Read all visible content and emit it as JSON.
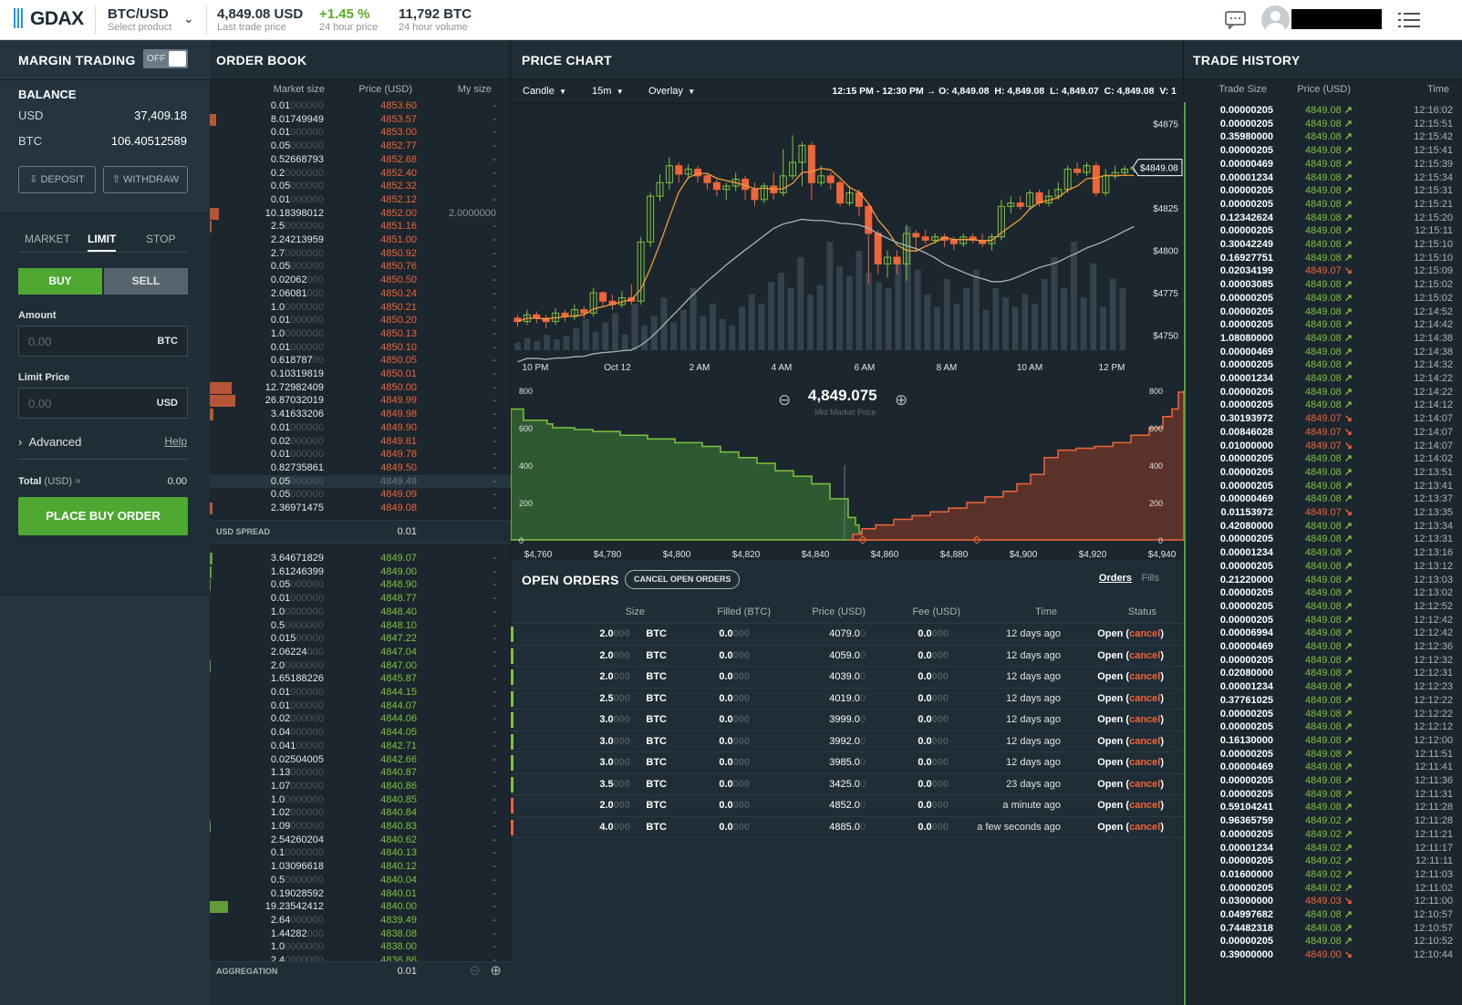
{
  "header": {
    "logo": "GDAX",
    "product": "BTC/USD",
    "product_sub": "Select product",
    "last_price": "4,849.08 USD",
    "last_price_sub": "Last trade price",
    "change": "+1.45 %",
    "change_sub": "24 hour price",
    "volume": "11,792 BTC",
    "volume_sub": "24 hour volume"
  },
  "left": {
    "margin_title": "MARGIN TRADING",
    "toggle": "OFF",
    "balance_title": "BALANCE",
    "usd_label": "USD",
    "usd_value": "37,409.18",
    "btc_label": "BTC",
    "btc_value": "106.40512589",
    "deposit": "DEPOSIT",
    "withdraw": "WITHDRAW",
    "tabs": [
      "MARKET",
      "LIMIT",
      "STOP"
    ],
    "buy": "BUY",
    "sell": "SELL",
    "amount_label": "Amount",
    "amount_placeholder": "0.00",
    "amount_unit": "BTC",
    "limit_label": "Limit Price",
    "limit_placeholder": "0.00",
    "limit_unit": "USD",
    "advanced": "Advanced",
    "help": "Help",
    "total_label": "Total",
    "total_unit": "(USD) ≈",
    "total_value": "0.00",
    "place": "PLACE BUY ORDER"
  },
  "orderbook": {
    "title": "ORDER BOOK",
    "col_size": "Market size",
    "col_price": "Price (USD)",
    "col_my": "My size",
    "spread_label": "USD SPREAD",
    "spread_value": "0.01",
    "aggregation_label": "AGGREGATION",
    "aggregation_value": "0.01",
    "asks": [
      [
        "0.01",
        "000000",
        "4853.",
        "60",
        "-"
      ],
      [
        "8.01749949",
        "",
        "4853.",
        "57",
        "-"
      ],
      [
        "0.01",
        "000000",
        "4853.",
        "00",
        "-"
      ],
      [
        "0.05",
        "000000",
        "4852.",
        "77",
        "-"
      ],
      [
        "0.52668793",
        "",
        "4852.",
        "68",
        "-"
      ],
      [
        "0.2",
        "0000000",
        "4852.",
        "40",
        "-"
      ],
      [
        "0.05",
        "000000",
        "4852.",
        "32",
        "-"
      ],
      [
        "0.01",
        "000000",
        "4852.",
        "12",
        "-"
      ],
      [
        "10.18398012",
        "",
        "4852.",
        "00",
        "2.0000000"
      ],
      [
        "2.5",
        "0000000",
        "4851.",
        "16",
        "-"
      ],
      [
        "2.24213959",
        "",
        "4851.",
        "00",
        "-"
      ],
      [
        "2.7",
        "0000000",
        "4850.",
        "92",
        "-"
      ],
      [
        "0.05",
        "000000",
        "4850.",
        "76",
        "-"
      ],
      [
        "0.02062",
        "000",
        "4850.",
        "50",
        "-"
      ],
      [
        "2.06081",
        "000",
        "4850.",
        "24",
        "-"
      ],
      [
        "1.0",
        "0000000",
        "4850.",
        "21",
        "-"
      ],
      [
        "0.01",
        "000000",
        "4850.",
        "20",
        "-"
      ],
      [
        "1.0",
        "0000000",
        "4850.",
        "13",
        "-"
      ],
      [
        "0.01",
        "000000",
        "4850.",
        "10",
        "-"
      ],
      [
        "0.618787",
        "00",
        "4850.",
        "05",
        "-"
      ],
      [
        "0.10319819",
        "",
        "4850.",
        "01",
        "-"
      ],
      [
        "12.72982409",
        "",
        "4850.",
        "00",
        "-"
      ],
      [
        "26.87032019",
        "",
        "4849.",
        "99",
        "-"
      ],
      [
        "3.41633206",
        "",
        "4849.",
        "98",
        "-"
      ],
      [
        "0.01",
        "000000",
        "4849.",
        "90",
        "-"
      ],
      [
        "0.02",
        "000000",
        "4849.",
        "81",
        "-"
      ],
      [
        "0.01",
        "000000",
        "4849.",
        "78",
        "-"
      ],
      [
        "0.82735861",
        "",
        "4849.",
        "50",
        "-"
      ],
      [
        "0.05",
        "000000",
        "4849.",
        "49",
        "-"
      ],
      [
        "0.05",
        "000000",
        "4849.",
        "09",
        "-"
      ],
      [
        "2.36971475",
        "",
        "4849.",
        "08",
        "-"
      ]
    ],
    "bids": [
      [
        "3.64671829",
        "",
        "4849.",
        "07",
        "-"
      ],
      [
        "1.61246399",
        "",
        "4849.",
        "00",
        "-"
      ],
      [
        "0.05",
        "000000",
        "4848.",
        "90",
        "-"
      ],
      [
        "0.01",
        "000000",
        "4848.",
        "77",
        "-"
      ],
      [
        "1.0",
        "0000000",
        "4848.",
        "40",
        "-"
      ],
      [
        "0.5",
        "0000000",
        "4848.",
        "10",
        "-"
      ],
      [
        "0.015",
        "00000",
        "4847.",
        "22",
        "-"
      ],
      [
        "2.06224",
        "000",
        "4847.",
        "04",
        "-"
      ],
      [
        "2.0",
        "0000000",
        "4847.",
        "00",
        "-"
      ],
      [
        "1.65188226",
        "",
        "4845.",
        "87",
        "-"
      ],
      [
        "0.01",
        "000000",
        "4844.",
        "15",
        "-"
      ],
      [
        "0.01",
        "000000",
        "4844.",
        "07",
        "-"
      ],
      [
        "0.02",
        "000000",
        "4844.",
        "06",
        "-"
      ],
      [
        "0.04",
        "000000",
        "4844.",
        "05",
        "-"
      ],
      [
        "0.041",
        "00000",
        "4842.",
        "71",
        "-"
      ],
      [
        "0.02504005",
        "",
        "4842.",
        "66",
        "-"
      ],
      [
        "1.13",
        "000000",
        "4840.",
        "87",
        "-"
      ],
      [
        "1.07",
        "000000",
        "4840.",
        "86",
        "-"
      ],
      [
        "1.0",
        "0000000",
        "4840.",
        "85",
        "-"
      ],
      [
        "1.02",
        "000000",
        "4840.",
        "84",
        "-"
      ],
      [
        "1.09",
        "000000",
        "4840.",
        "83",
        "-"
      ],
      [
        "2.54260204",
        "",
        "4840.",
        "62",
        "-"
      ],
      [
        "0.1",
        "0000000",
        "4840.",
        "13",
        "-"
      ],
      [
        "1.03096618",
        "",
        "4840.",
        "12",
        "-"
      ],
      [
        "0.5",
        "0000000",
        "4840.",
        "04",
        "-"
      ],
      [
        "0.19028592",
        "",
        "4840.",
        "01",
        "-"
      ],
      [
        "19.23542412",
        "",
        "4840.",
        "00",
        "-"
      ],
      [
        "2.64",
        "000000",
        "4839.",
        "49",
        "-"
      ],
      [
        "1.44282",
        "000",
        "4838.",
        "08",
        "-"
      ],
      [
        "1.0",
        "0000000",
        "4838.",
        "00",
        "-"
      ],
      [
        "2.4",
        "0000000",
        "4836.",
        "86",
        "-"
      ]
    ]
  },
  "chart": {
    "title": "PRICE CHART",
    "candle": "Candle",
    "interval": "15m",
    "overlay": "Overlay",
    "ohlc": "12:15 PM - 12:30 PM → O: 4,849.08  H: 4,849.08  L: 4,849.07  C: 4,849.08  V: 1",
    "y_labels": [
      "$4875",
      "$4825",
      "$4800",
      "$4775",
      "$4750"
    ],
    "price_tag": "$4849.08",
    "x_labels": [
      "10 PM",
      "Oct 12",
      "2 AM",
      "4 AM",
      "6 AM",
      "8 AM",
      "10 AM",
      "12 PM"
    ],
    "mid_price": "4,849.075",
    "mid_label": "Mid Market Price",
    "depth_y": [
      "800",
      "600",
      "400",
      "200",
      "0"
    ],
    "depth_x": [
      "$4,760",
      "$4,780",
      "$4,800",
      "$4,820",
      "$4,840",
      "$4,860",
      "$4,880",
      "$4,900",
      "$4,920",
      "$4,940"
    ]
  },
  "orders": {
    "title": "OPEN ORDERS",
    "cancel_all": "CANCEL OPEN ORDERS",
    "tab_orders": "Orders",
    "tab_fills": "Fills",
    "cols": [
      "Size",
      "Filled (BTC)",
      "Price (USD)",
      "Fee (USD)",
      "Time",
      "Status"
    ],
    "rows": [
      [
        "2.0",
        "BTC",
        "0.0",
        "4079.0",
        "0.0",
        "12 days ago",
        "buy"
      ],
      [
        "2.0",
        "BTC",
        "0.0",
        "4059.0",
        "0.0",
        "12 days ago",
        "buy"
      ],
      [
        "2.0",
        "BTC",
        "0.0",
        "4039.0",
        "0.0",
        "12 days ago",
        "buy"
      ],
      [
        "2.5",
        "BTC",
        "0.0",
        "4019.0",
        "0.0",
        "12 days ago",
        "buy"
      ],
      [
        "3.0",
        "BTC",
        "0.0",
        "3999.0",
        "0.0",
        "12 days ago",
        "buy"
      ],
      [
        "3.0",
        "BTC",
        "0.0",
        "3992.0",
        "0.0",
        "12 days ago",
        "buy"
      ],
      [
        "3.0",
        "BTC",
        "0.0",
        "3985.0",
        "0.0",
        "12 days ago",
        "buy"
      ],
      [
        "3.5",
        "BTC",
        "0.0",
        "3425.0",
        "0.0",
        "23 days ago",
        "buy"
      ],
      [
        "2.0",
        "BTC",
        "0.0",
        "4852.0",
        "0.0",
        "a minute ago",
        "sell"
      ],
      [
        "4.0",
        "BTC",
        "0.0",
        "4885.0",
        "0.0",
        "a few seconds ago",
        "sell"
      ]
    ],
    "open": "Open",
    "cancel": "cancel"
  },
  "trades": {
    "title": "TRADE HISTORY",
    "col_size": "Trade Size",
    "col_price": "Price (USD)",
    "col_time": "Time",
    "rows": [
      [
        "0.00000205",
        "4849.08",
        "up",
        "12:16:02"
      ],
      [
        "0.00000205",
        "4849.08",
        "up",
        "12:15:51"
      ],
      [
        "0.35980000",
        "4849.08",
        "up",
        "12:15:42"
      ],
      [
        "0.00000205",
        "4849.08",
        "up",
        "12:15:41"
      ],
      [
        "0.00000469",
        "4849.08",
        "up",
        "12:15:39"
      ],
      [
        "0.00001234",
        "4849.08",
        "up",
        "12:15:34"
      ],
      [
        "0.00000205",
        "4849.08",
        "up",
        "12:15:31"
      ],
      [
        "0.00000205",
        "4849.08",
        "up",
        "12:15:21"
      ],
      [
        "0.12342624",
        "4849.08",
        "up",
        "12:15:20"
      ],
      [
        "0.00000205",
        "4849.08",
        "up",
        "12:15:11"
      ],
      [
        "0.30042249",
        "4849.08",
        "up",
        "12:15:10"
      ],
      [
        "0.16927751",
        "4849.08",
        "up",
        "12:15:10"
      ],
      [
        "0.02034199",
        "4849.07",
        "down",
        "12:15:09"
      ],
      [
        "0.00003085",
        "4849.08",
        "up",
        "12:15:02"
      ],
      [
        "0.00000205",
        "4849.08",
        "up",
        "12:15:02"
      ],
      [
        "0.00000205",
        "4849.08",
        "up",
        "12:14:52"
      ],
      [
        "0.00000205",
        "4849.08",
        "up",
        "12:14:42"
      ],
      [
        "1.08080000",
        "4849.08",
        "up",
        "12:14:38"
      ],
      [
        "0.00000469",
        "4849.08",
        "up",
        "12:14:38"
      ],
      [
        "0.00000205",
        "4849.08",
        "up",
        "12:14:32"
      ],
      [
        "0.00001234",
        "4849.08",
        "up",
        "12:14:22"
      ],
      [
        "0.00000205",
        "4849.08",
        "up",
        "12:14:22"
      ],
      [
        "0.00000205",
        "4849.08",
        "up",
        "12:14:12"
      ],
      [
        "0.30193972",
        "4849.07",
        "down",
        "12:14:07"
      ],
      [
        "0.00846028",
        "4849.07",
        "down",
        "12:14:07"
      ],
      [
        "0.01000000",
        "4849.07",
        "down",
        "12:14:07"
      ],
      [
        "0.00000205",
        "4849.08",
        "up",
        "12:14:02"
      ],
      [
        "0.00000205",
        "4849.08",
        "up",
        "12:13:51"
      ],
      [
        "0.00000205",
        "4849.08",
        "up",
        "12:13:41"
      ],
      [
        "0.00000469",
        "4849.08",
        "up",
        "12:13:37"
      ],
      [
        "0.01153972",
        "4849.07",
        "down",
        "12:13:35"
      ],
      [
        "0.42080000",
        "4849.08",
        "up",
        "12:13:34"
      ],
      [
        "0.00000205",
        "4849.08",
        "up",
        "12:13:31"
      ],
      [
        "0.00001234",
        "4849.08",
        "up",
        "12:13:16"
      ],
      [
        "0.00000205",
        "4849.08",
        "up",
        "12:13:12"
      ],
      [
        "0.21220000",
        "4849.08",
        "up",
        "12:13:03"
      ],
      [
        "0.00000205",
        "4849.08",
        "up",
        "12:13:02"
      ],
      [
        "0.00000205",
        "4849.08",
        "up",
        "12:12:52"
      ],
      [
        "0.00000205",
        "4849.08",
        "up",
        "12:12:42"
      ],
      [
        "0.00006994",
        "4849.08",
        "up",
        "12:12:42"
      ],
      [
        "0.00000469",
        "4849.08",
        "up",
        "12:12:36"
      ],
      [
        "0.00000205",
        "4849.08",
        "up",
        "12:12:32"
      ],
      [
        "0.02080000",
        "4849.08",
        "up",
        "12:12:31"
      ],
      [
        "0.00001234",
        "4849.08",
        "up",
        "12:12:23"
      ],
      [
        "0.37761025",
        "4849.08",
        "up",
        "12:12:22"
      ],
      [
        "0.00000205",
        "4849.08",
        "up",
        "12:12:22"
      ],
      [
        "0.00000205",
        "4849.08",
        "up",
        "12:12:12"
      ],
      [
        "0.16130000",
        "4849.08",
        "up",
        "12:12:00"
      ],
      [
        "0.00000205",
        "4849.08",
        "up",
        "12:11:51"
      ],
      [
        "0.00000469",
        "4849.08",
        "up",
        "12:11:41"
      ],
      [
        "0.00000205",
        "4849.08",
        "up",
        "12:11:36"
      ],
      [
        "0.00000205",
        "4849.08",
        "up",
        "12:11:31"
      ],
      [
        "0.59104241",
        "4849.08",
        "up",
        "12:11:28"
      ],
      [
        "0.96365759",
        "4849.02",
        "up",
        "12:11:28"
      ],
      [
        "0.00000205",
        "4849.02",
        "up",
        "12:11:21"
      ],
      [
        "0.00001234",
        "4849.02",
        "up",
        "12:11:17"
      ],
      [
        "0.00000205",
        "4849.02",
        "up",
        "12:11:11"
      ],
      [
        "0.01600000",
        "4849.02",
        "up",
        "12:11:03"
      ],
      [
        "0.00000205",
        "4849.02",
        "up",
        "12:11:02"
      ],
      [
        "0.03000000",
        "4849.03",
        "down",
        "12:11:00"
      ],
      [
        "0.04997682",
        "4849.08",
        "up",
        "12:10:57"
      ],
      [
        "0.74482318",
        "4849.08",
        "up",
        "12:10:57"
      ],
      [
        "0.00000205",
        "4849.08",
        "up",
        "12:10:52"
      ],
      [
        "0.39000000",
        "4849.00",
        "down",
        "12:10:44"
      ]
    ]
  },
  "colors": {
    "green": "#7ec33e",
    "red": "#f0643a",
    "bg": "#1b262e",
    "panel": "#243541"
  }
}
